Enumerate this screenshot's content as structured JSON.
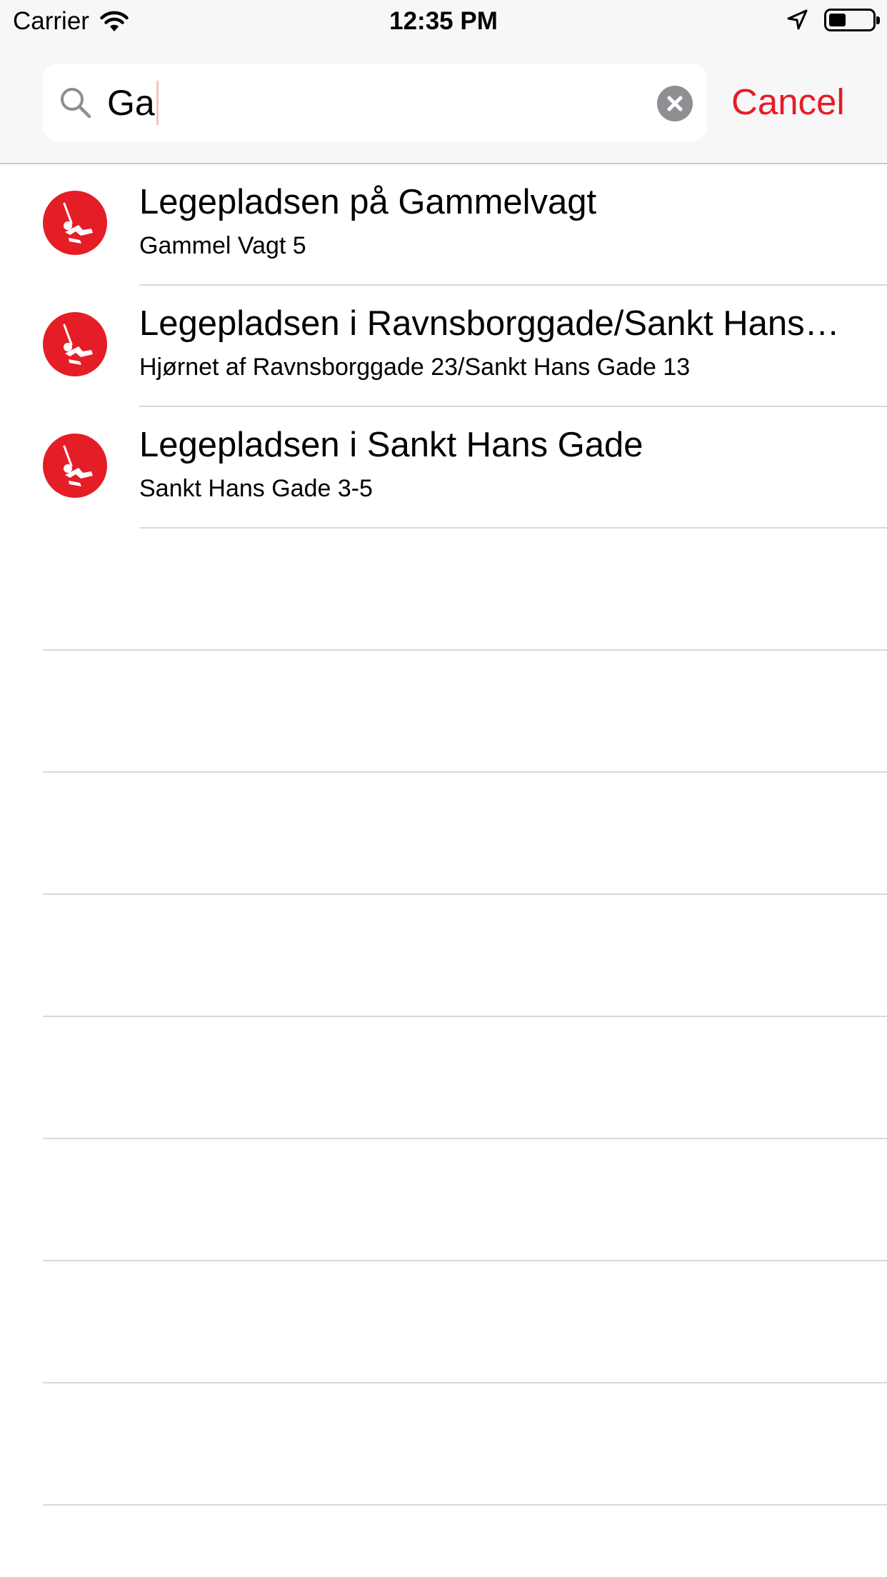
{
  "status_bar": {
    "carrier": "Carrier",
    "time": "12:35 PM",
    "battery_level": 0.4
  },
  "search": {
    "query": "Ga",
    "cancel_label": "Cancel"
  },
  "colors": {
    "accent": "#e41d26",
    "separator": "#d9d9dd",
    "clear_button": "#8e8e93"
  },
  "results": [
    {
      "title": "Legepladsen på Gammelvagt",
      "subtitle": "Gammel Vagt 5",
      "icon": "playground-swing-icon"
    },
    {
      "title": "Legepladsen i Ravnsborggade/Sankt Hans Gade",
      "subtitle": "Hjørnet af Ravnsborggade 23/Sankt Hans Gade 13",
      "icon": "playground-swing-icon"
    },
    {
      "title": "Legepladsen i Sankt Hans Gade",
      "subtitle": "Sankt Hans Gade 3-5",
      "icon": "playground-swing-icon"
    }
  ]
}
